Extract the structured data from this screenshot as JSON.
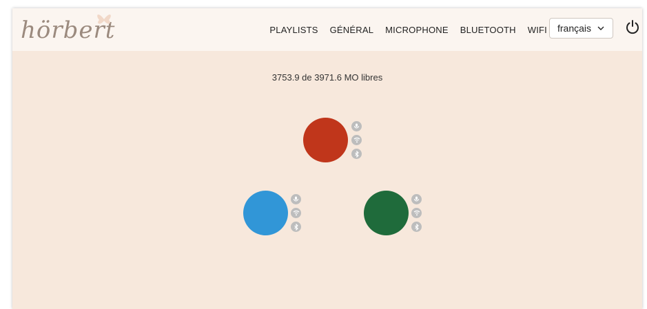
{
  "app": {
    "logo_text": "hörbert"
  },
  "nav": {
    "items": [
      {
        "label": "PLAYLISTS"
      },
      {
        "label": "GÉNÉRAL"
      },
      {
        "label": "MICROPHONE"
      },
      {
        "label": "BLUETOOTH"
      },
      {
        "label": "WIFI"
      }
    ]
  },
  "language": {
    "selected": "français"
  },
  "storage": {
    "text": "3753.9 de 3971.6 MO libres"
  },
  "devices": [
    {
      "color": "#c0361b",
      "icons": [
        "microphone-icon",
        "wifi-icon",
        "bluetooth-icon"
      ]
    },
    {
      "color": "#3196d7",
      "icons": [
        "microphone-icon",
        "wifi-icon",
        "bluetooth-icon"
      ]
    },
    {
      "color": "#1f6b3b",
      "icons": [
        "microphone-icon",
        "wifi-icon",
        "bluetooth-icon"
      ]
    }
  ]
}
